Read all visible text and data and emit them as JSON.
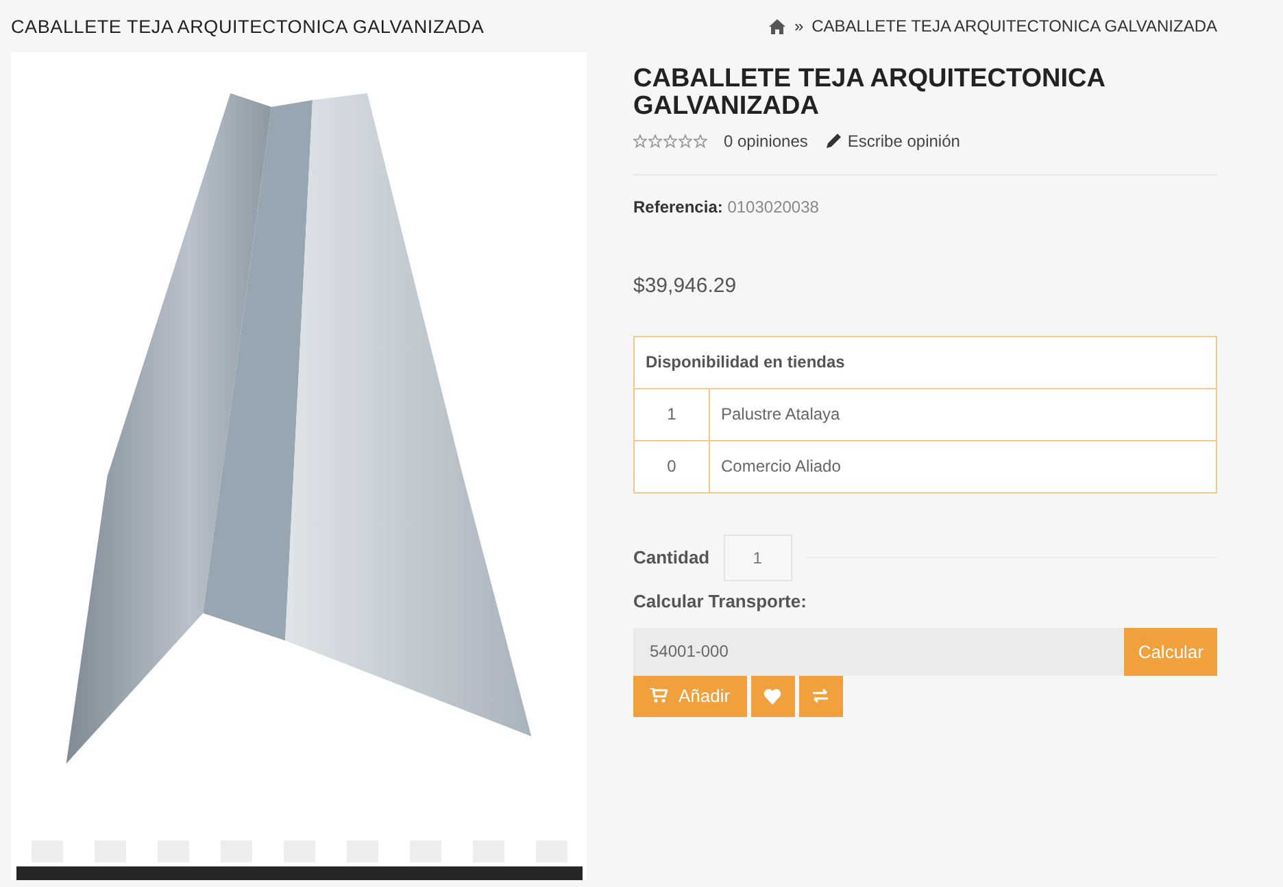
{
  "page_title": "CABALLETE TEJA ARQUITECTONICA GALVANIZADA",
  "breadcrumb": {
    "separator": "»",
    "current": "CABALLETE TEJA ARQUITECTONICA GALVANIZADA"
  },
  "product": {
    "title": "CABALLETE TEJA ARQUITECTONICA GALVANIZADA",
    "stars": 0,
    "reviews": "0 opiniones",
    "write_review": "Escribe opinión",
    "reference_label": "Referencia:",
    "reference": "0103020038",
    "price": "$39,946.29"
  },
  "availability": {
    "heading": "Disponibilidad en tiendas",
    "rows": [
      {
        "count": "1",
        "store": "Palustre Atalaya"
      },
      {
        "count": "0",
        "store": "Comercio Aliado"
      }
    ]
  },
  "quantity": {
    "label": "Cantidad",
    "value": "1"
  },
  "shipping": {
    "label": "Calcular Transporte:",
    "value": "54001-000",
    "button": "Calcular"
  },
  "add_button": "Añadir"
}
